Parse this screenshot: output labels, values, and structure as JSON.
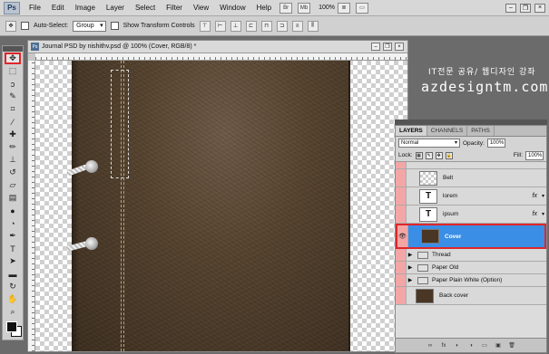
{
  "app": {
    "logo": "Ps"
  },
  "menu": [
    "File",
    "Edit",
    "Image",
    "Layer",
    "Select",
    "Filter",
    "View",
    "Window",
    "Help"
  ],
  "menubar_icons": [
    "Br",
    "Mb",
    "100%",
    "≣",
    "▭",
    "✋",
    "🔍",
    "▦",
    "▥"
  ],
  "zoom": "100%",
  "options": {
    "auto_select_label": "Auto-Select:",
    "auto_select_value": "Group",
    "transform_label": "Show Transform Controls"
  },
  "document": {
    "title": "Journal PSD by nishithv.psd @ 100% (Cover, RGB/8) *"
  },
  "watermark": {
    "line1": "IT전문 공유/ 웹디자인 강좌",
    "line2": "azdesigntm.com"
  },
  "layers_panel": {
    "tabs": [
      "LAYERS",
      "CHANNELS",
      "PATHS"
    ],
    "blend_mode": "Normal",
    "opacity_label": "Opacity:",
    "opacity_value": "100%",
    "lock_label": "Lock:",
    "fill_label": "Fill:",
    "fill_value": "100%",
    "layers": [
      {
        "name": "Belt",
        "thumb": "",
        "fx": ""
      },
      {
        "name": "lorem",
        "thumb": "T",
        "fx": "fx"
      },
      {
        "name": "ipsum",
        "thumb": "T",
        "fx": "fx"
      },
      {
        "name": "Cover",
        "thumb": "",
        "fx": ""
      },
      {
        "name": "Thread",
        "thumb": "",
        "fx": ""
      },
      {
        "name": "Paper Old",
        "thumb": "",
        "fx": ""
      },
      {
        "name": "Paper Plain White (Option)",
        "thumb": "",
        "fx": ""
      },
      {
        "name": "Back cover",
        "thumb": "",
        "fx": ""
      }
    ],
    "bottom_icons": [
      "∞",
      "fx",
      "◐",
      "◑",
      "▭",
      "▣",
      "🗑"
    ]
  },
  "colors": {
    "selection_highlight": "#3a8ee6",
    "annotation_red": "#e0262a"
  }
}
